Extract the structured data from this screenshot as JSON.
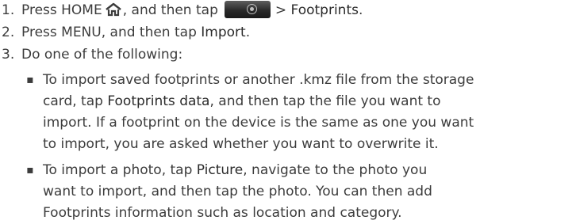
{
  "steps": [
    {
      "number": "1.",
      "text_before": "Press HOME",
      "text_mid": ", and then tap",
      "text_after": "> ",
      "bold": "Footprints",
      "end": "."
    },
    {
      "number": "2.",
      "text_before": "Press MENU, and then tap ",
      "bold": "Import",
      "end": "."
    },
    {
      "number": "3.",
      "text": "Do one of the following:"
    }
  ],
  "bullets": [
    {
      "line1": "To import saved footprints or another .kmz file from the storage",
      "line2_before": "card, tap ",
      "line2_bold": "Footprints data",
      "line2_after": ", and then tap the file you want to",
      "line3": "import. If a footprint on the device is the same as one you want",
      "line4": "to import, you are asked whether you want to overwrite it."
    },
    {
      "line1_before": "To import a photo, tap ",
      "line1_bold": "Picture",
      "line1_after": ", navigate to the photo you",
      "line2": "want to import, and then tap the photo. You can then add",
      "line3": "Footprints information such as location and category."
    }
  ],
  "icons": {
    "home": "home-icon",
    "app": "footprints-app-icon"
  }
}
